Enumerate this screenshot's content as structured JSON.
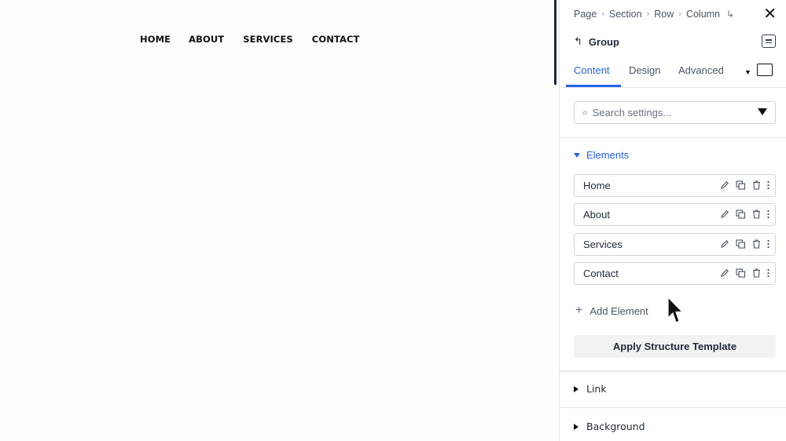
{
  "site": {
    "nav": [
      "HOME",
      "ABOUT",
      "SERVICES",
      "CONTACT"
    ]
  },
  "panel": {
    "breadcrumbs": [
      "Page",
      "Section",
      "Row",
      "Column"
    ],
    "group_label": "Group",
    "tabs": [
      "Content",
      "Design",
      "Advanced"
    ],
    "active_tab": "Content",
    "search_placeholder": "Search settings...",
    "elements_section": "Elements",
    "elements": [
      "Home",
      "About",
      "Services",
      "Contact"
    ],
    "add_element": "Add Element",
    "apply_template": "Apply Structure Template",
    "sections": [
      "Link",
      "Background"
    ],
    "accent_color": "#2563eb",
    "icons": {
      "crumb_enter": "↳",
      "back": "↰",
      "close": "✕",
      "search": "⌕",
      "plus": "+"
    }
  }
}
